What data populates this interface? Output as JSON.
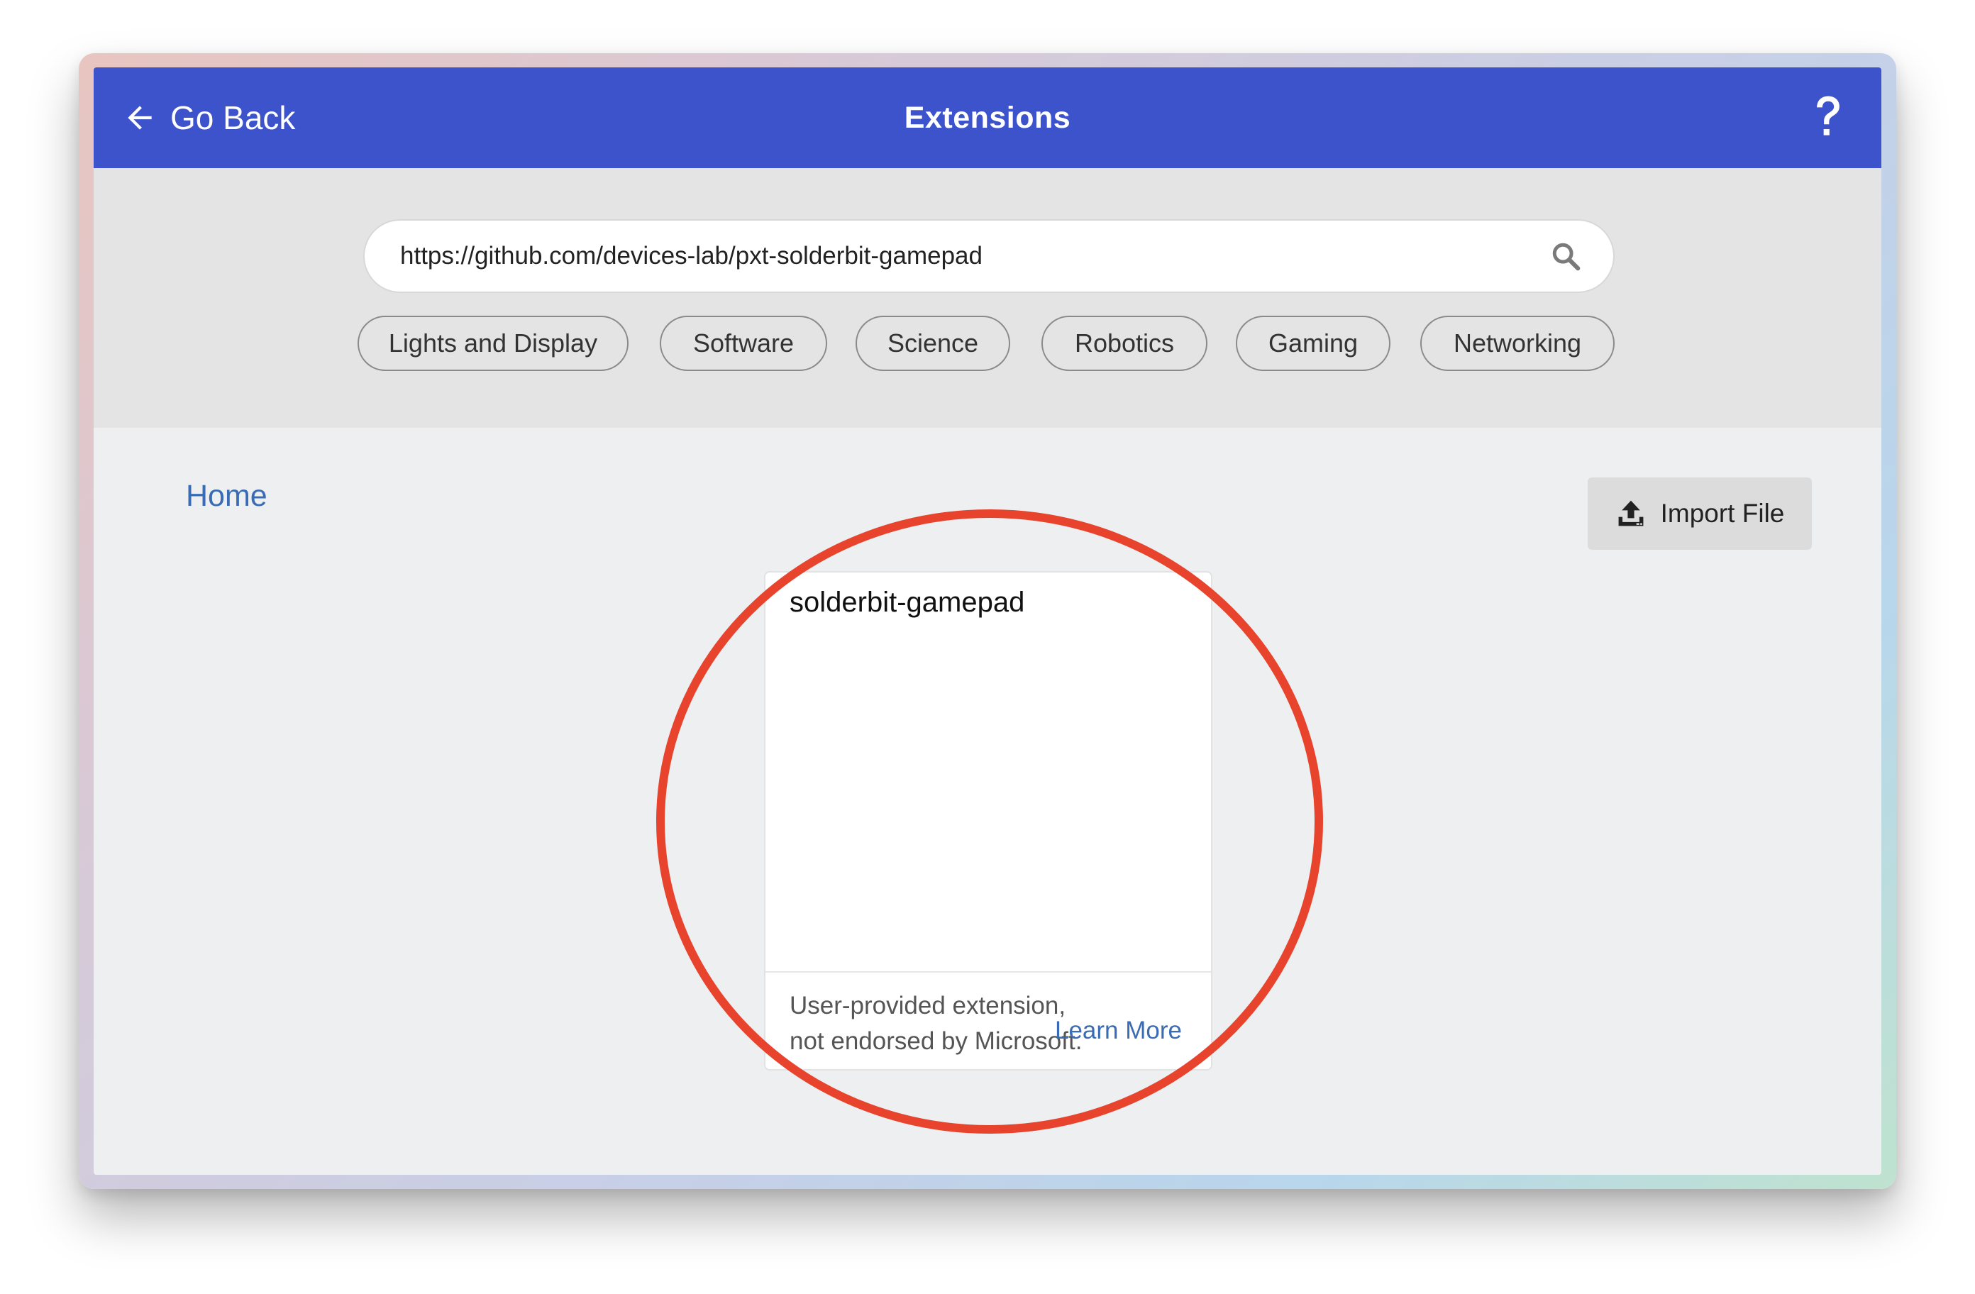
{
  "header": {
    "back_label": "Go Back",
    "title": "Extensions",
    "help_icon": "question-mark-icon",
    "back_icon": "arrow-left-icon",
    "bg_color": "#3c53cc"
  },
  "search": {
    "value": "https://github.com/devices-lab/pxt-solderbit-gamepad",
    "icon": "search-icon"
  },
  "categories": [
    "Lights and Display",
    "Software",
    "Science",
    "Robotics",
    "Gaming",
    "Networking"
  ],
  "breadcrumb": {
    "home_label": "Home"
  },
  "import": {
    "label": "Import File",
    "icon": "upload-icon"
  },
  "result_card": {
    "title": "solderbit-gamepad",
    "disclaimer": "User-provided extension, not endorsed by Microsoft.",
    "learn_more": "Learn More"
  },
  "colors": {
    "link": "#3a6cb5",
    "annotation": "#e8432d"
  }
}
